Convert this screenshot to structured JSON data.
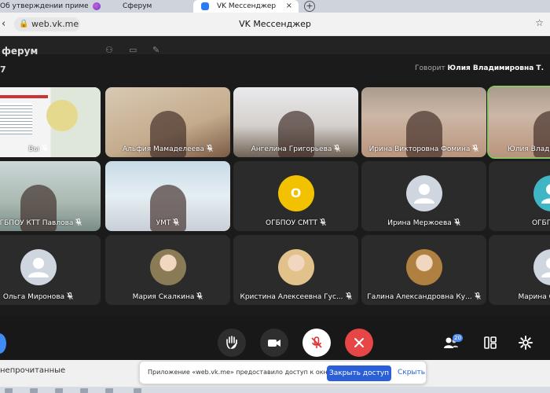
{
  "browser": {
    "tabs": [
      {
        "label": "Об утверждении пример..."
      },
      {
        "label": "Сферум"
      },
      {
        "label": "VK Мессенджер",
        "active": true
      }
    ],
    "close_glyph": "×",
    "new_tab_glyph": "+",
    "url": "web.vk.me",
    "page_title": "VK Мессенджер"
  },
  "app": {
    "name": "ферум"
  },
  "call": {
    "left_label": "7",
    "speaker_prefix": "Говорит",
    "speaker_name": "Юлия Владимировна Т.",
    "tiles": [
      {
        "label": "Вы",
        "muted": true,
        "kind": "video",
        "scene": "scene-slide"
      },
      {
        "label": "Альфия Мамаделеева",
        "muted": true,
        "kind": "video",
        "scene": "scene-room1"
      },
      {
        "label": "Ангелина Григорьева",
        "muted": true,
        "kind": "video",
        "scene": "scene-room2"
      },
      {
        "label": "Ирина Викторовна Фомина",
        "muted": true,
        "kind": "video",
        "scene": "scene-room3"
      },
      {
        "label": "Юлия Владимировна Т.",
        "muted": false,
        "kind": "video",
        "scene": "scene-room3",
        "active": true
      },
      {
        "label": "ОГБПОУ КТТ Павлова",
        "muted": true,
        "kind": "video",
        "scene": "scene-room4"
      },
      {
        "label": "УМТ",
        "muted": true,
        "kind": "video",
        "scene": "scene-room6"
      },
      {
        "label": "ОГБПОУ СМТТ",
        "muted": true,
        "kind": "letter",
        "letter": "О"
      },
      {
        "label": "Ирина Мержоева",
        "muted": true,
        "kind": "default"
      },
      {
        "label": "ОГБПОУ",
        "muted": true,
        "kind": "default",
        "teal": true
      },
      {
        "label": "Ольга Миронова",
        "muted": true,
        "kind": "default"
      },
      {
        "label": "Мария Скалкина",
        "muted": true,
        "kind": "photo",
        "color": "#8a7a55"
      },
      {
        "label": "Кристина Алексеевна Гус...",
        "muted": true,
        "kind": "photo",
        "color": "#e0c28a"
      },
      {
        "label": "Галина Александровна Ку...",
        "muted": true,
        "kind": "photo",
        "color": "#b08040"
      },
      {
        "label": "Марина Олегов",
        "muted": true,
        "kind": "default"
      }
    ],
    "participants_count": "20"
  },
  "sidebar": {
    "unread_label": "непрочитанные"
  },
  "notification": {
    "text": "Приложение «web.vk.me» предоставило доступ к окну.",
    "button": "Закрыть доступ",
    "hide": "Скрыть"
  },
  "colors": {
    "accent": "#2a5fd8",
    "end_call": "#e64646",
    "active_outline": "#8cc36b",
    "badge": "#4d8bf5"
  }
}
